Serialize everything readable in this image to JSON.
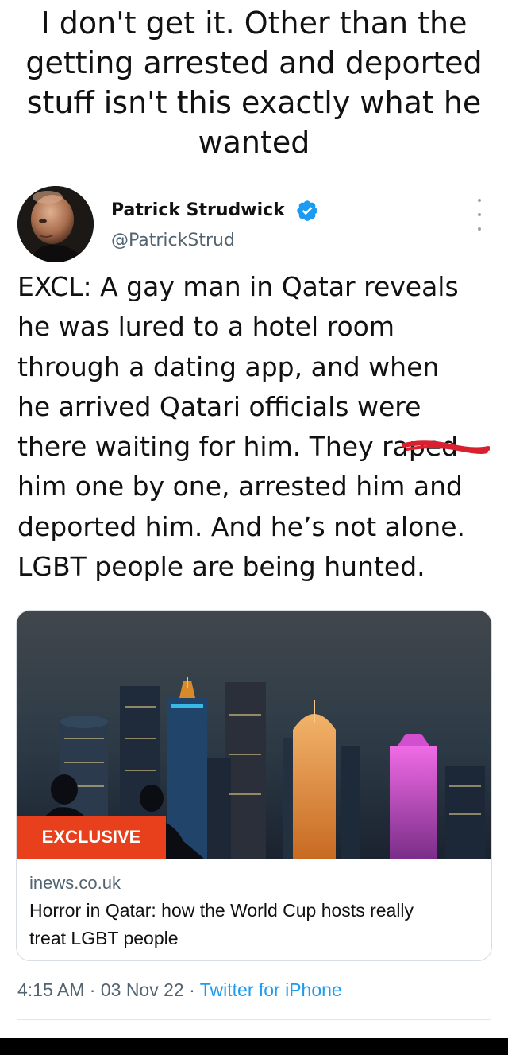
{
  "caption": {
    "lines": [
      "I don't get it. Other than the",
      "getting arrested and deported",
      "stuff isn't this exactly what he",
      "wanted"
    ]
  },
  "tweet": {
    "author_name": "Patrick Strudwick",
    "handle": "@PatrickStrud",
    "icons": {
      "verified": "verified-badge-icon",
      "more": "more-options-icon"
    },
    "text_lines": [
      "EXCL: A gay man in Qatar reveals",
      "he was lured to a hotel room",
      "through a dating app, and when",
      "he arrived Qatari officials were",
      "there waiting for him. They raped",
      "him one by one, arrested him and",
      "deported him. And he’s not alone.",
      "LGBT people are being hunted."
    ],
    "card": {
      "badge": "EXCLUSIVE",
      "domain": "inews.co.uk",
      "title_lines": [
        "Horror in Qatar: how the World Cup hosts really",
        "treat LGBT people"
      ]
    },
    "meta": {
      "time": "4:15 AM",
      "separator": "·",
      "date": "03 Nov 22",
      "source": "Twitter for iPhone"
    }
  },
  "colors": {
    "verified_blue": "#1d9bf0",
    "link_blue": "#1d9bf0",
    "secondary_text": "#536471",
    "badge_red": "#e8401c",
    "redaction_red": "#d9202f"
  }
}
